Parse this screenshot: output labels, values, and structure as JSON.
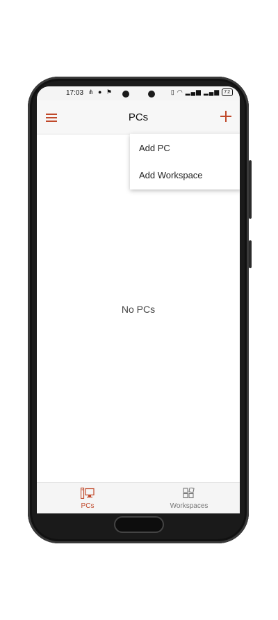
{
  "status_bar": {
    "time": "17:03",
    "battery": "72"
  },
  "app_bar": {
    "title": "PCs",
    "menu_icon": "hamburger-menu-icon",
    "add_icon": "plus-icon"
  },
  "dropdown_menu": {
    "items": [
      {
        "label": "Add PC"
      },
      {
        "label": "Add Workspace"
      }
    ]
  },
  "main": {
    "empty_message": "No PCs"
  },
  "bottom_nav": {
    "tabs": [
      {
        "label": "PCs",
        "icon": "pc-icon",
        "active": true
      },
      {
        "label": "Workspaces",
        "icon": "workspaces-icon",
        "active": false
      }
    ]
  },
  "colors": {
    "accent": "#c0492b",
    "inactive": "#777777"
  }
}
